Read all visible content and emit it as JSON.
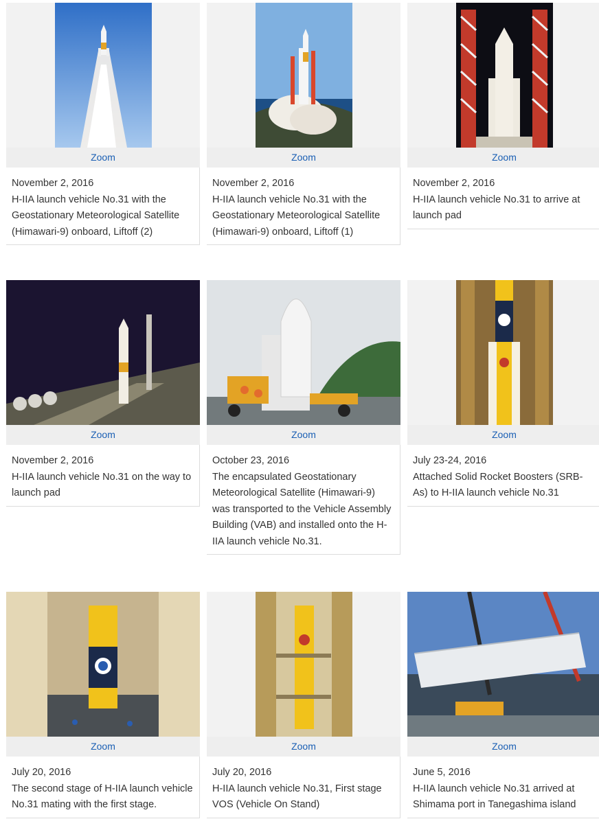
{
  "zoom_label": "Zoom",
  "items": [
    {
      "date": "November 2, 2016",
      "text": "H-IIA launch vehicle No.31 with the Geostationary Meteorological Satellite (Himawari-9) onboard, Liftoff (2)",
      "photo": "liftoff-2"
    },
    {
      "date": "November 2, 2016",
      "text": "H-IIA launch vehicle No.31 with the Geostationary Meteorological Satellite (Himawari-9) onboard, Liftoff (1)",
      "photo": "liftoff-1"
    },
    {
      "date": "November 2, 2016",
      "text": "H-IIA launch vehicle No.31 to arrive at launch pad",
      "photo": "arrive-launch-pad"
    },
    {
      "date": "November 2, 2016",
      "text": "H-IIA launch vehicle No.31 on the way to launch pad",
      "photo": "way-to-launch-pad"
    },
    {
      "date": "October 23, 2016",
      "text": "The encapsulated Geostationary Meteorological Satellite (Himawari-9) was transported to the Vehicle Assembly Building (VAB) and installed onto the H-IIA launch vehicle No.31.",
      "photo": "encapsulated-satellite-transport"
    },
    {
      "date": "July 23-24, 2016",
      "text": "Attached Solid Rocket Boosters (SRB-As) to H-IIA launch vehicle No.31",
      "photo": "srb-attach"
    },
    {
      "date": "July 20, 2016",
      "text": "The second stage of H-IIA launch vehicle No.31 mating with the first stage.",
      "photo": "second-stage-mating"
    },
    {
      "date": "July 20, 2016",
      "text": "H-IIA launch vehicle No.31, First stage VOS (Vehicle On Stand)",
      "photo": "first-stage-vos"
    },
    {
      "date": "June 5, 2016",
      "text": "H-IIA launch vehicle No.31 arrived at Shimama port in Tanegashima island",
      "photo": "arrival-shimama-port"
    }
  ]
}
